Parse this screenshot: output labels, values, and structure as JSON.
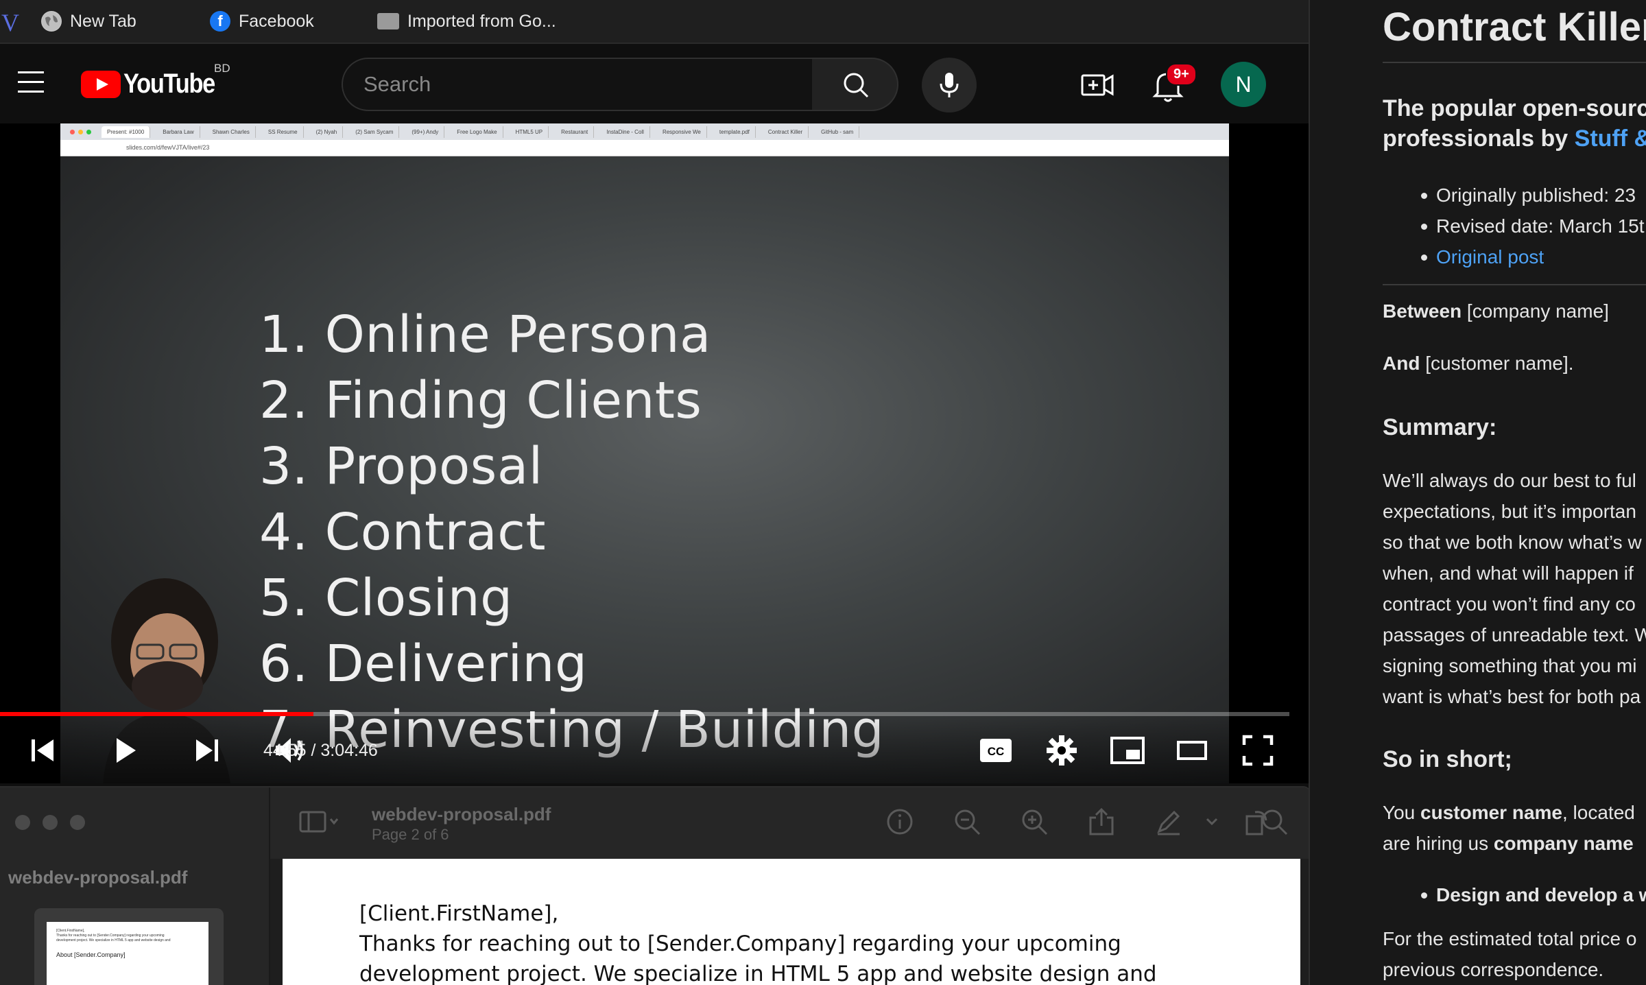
{
  "bookmarks": {
    "items": [
      {
        "label": "New Tab",
        "icon": "globe-icon"
      },
      {
        "label": "Facebook",
        "icon": "facebook-icon"
      },
      {
        "label": "Imported from Go...",
        "icon": "folder-icon"
      }
    ]
  },
  "youtube": {
    "logo_text": "YouTube",
    "region": "BD",
    "search_placeholder": "Search",
    "notification_count": "9+",
    "avatar_letter": "N"
  },
  "player": {
    "slide_items": [
      "1. Online Persona",
      "2. Finding Clients",
      "3. Proposal",
      "4. Contract",
      "5. Closing",
      "6. Delivering",
      "7. Reinvesting / Building"
    ],
    "time_display": "44:55 / 3:04:46",
    "progress_fraction": 0.243,
    "accent_color": "#ff0000",
    "recorded_url": "slides.com/d/fewVJTA/live#/23"
  },
  "preview": {
    "sidebar_title": "webdev-proposal.pdf",
    "doc_title": "webdev-proposal.pdf",
    "page_indicator": "Page 2 of 6",
    "thumb_heading": "About [Sender.Company]",
    "page_lines": [
      "[Client.FirstName],",
      "Thanks for reaching out to  [Sender.Company] regarding your upcoming",
      "development project. We specialize in HTML 5 app and website design and"
    ]
  },
  "doc": {
    "title": "Contract Killer",
    "subtitle_line1": "The popular open-sourc",
    "subtitle_line2_prefix": "professionals by ",
    "subtitle_link": "Stuff &",
    "bullets": [
      "Originally published: 23",
      "Revised date: March 15t"
    ],
    "original_post_link": "Original post",
    "between_label": "Between",
    "between_value": " [company name]",
    "and_label": "And",
    "and_value": " [customer name].",
    "summary_heading": "Summary:",
    "summary_lines": [
      "We’ll always do our best to ful",
      "expectations, but it’s importan",
      "so that we both know what’s w",
      "when, and what will happen if",
      "contract you won’t find any co",
      "passages of unreadable text. W",
      "signing something that you mi",
      "want is what’s best for both pa"
    ],
    "short_heading": "So in short;",
    "short_line1_prefix": "You ",
    "short_line1_bold": "customer name",
    "short_line1_suffix": ", located",
    "short_line2_prefix": "are hiring us ",
    "short_line2_bold": "company name",
    "design_bullet": "Design and develop a w",
    "price_lines": [
      "For the estimated total price o",
      "previous correspondence."
    ],
    "link_color": "#4ea2f5"
  }
}
